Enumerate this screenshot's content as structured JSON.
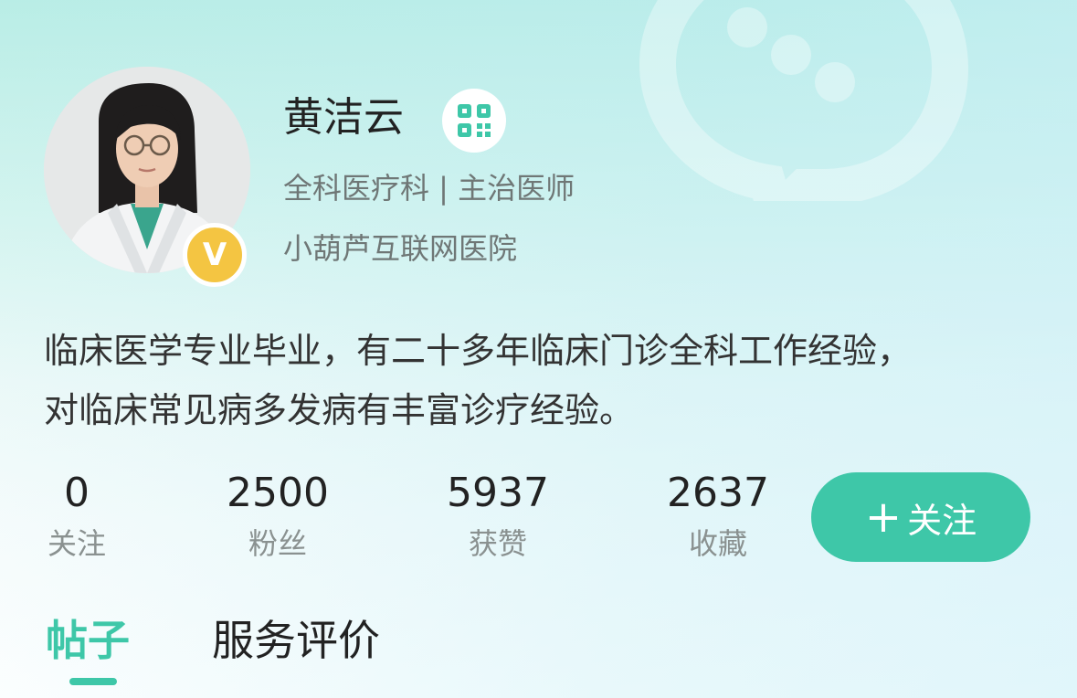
{
  "profile": {
    "name": "黄洁云",
    "subtitle": "全科医疗科 | 主治医师",
    "hospital": "小葫芦互联网医院",
    "verified_badge": "V",
    "bio_lines": [
      "临床医学专业毕业，有二十多年临床门诊全科工作经验，",
      "对临床常见病多发病有丰富诊疗经验。"
    ]
  },
  "icons": {
    "qr": "qr-code-icon",
    "verified": "verified-v-icon",
    "chat_bubble": "chat-bubble-icon"
  },
  "stats": [
    {
      "value": "0",
      "label": "关注"
    },
    {
      "value": "2500",
      "label": "粉丝"
    },
    {
      "value": "5937",
      "label": "获赞"
    },
    {
      "value": "2637",
      "label": "收藏"
    }
  ],
  "follow_button": {
    "plus": "+",
    "label": "关注"
  },
  "tabs": [
    {
      "label": "帖子",
      "active": true
    },
    {
      "label": "服务评价",
      "active": false
    }
  ],
  "colors": {
    "accent": "#3ec7a8",
    "badge": "#f4c542",
    "text_primary": "#222222",
    "text_secondary": "#6f7776"
  }
}
